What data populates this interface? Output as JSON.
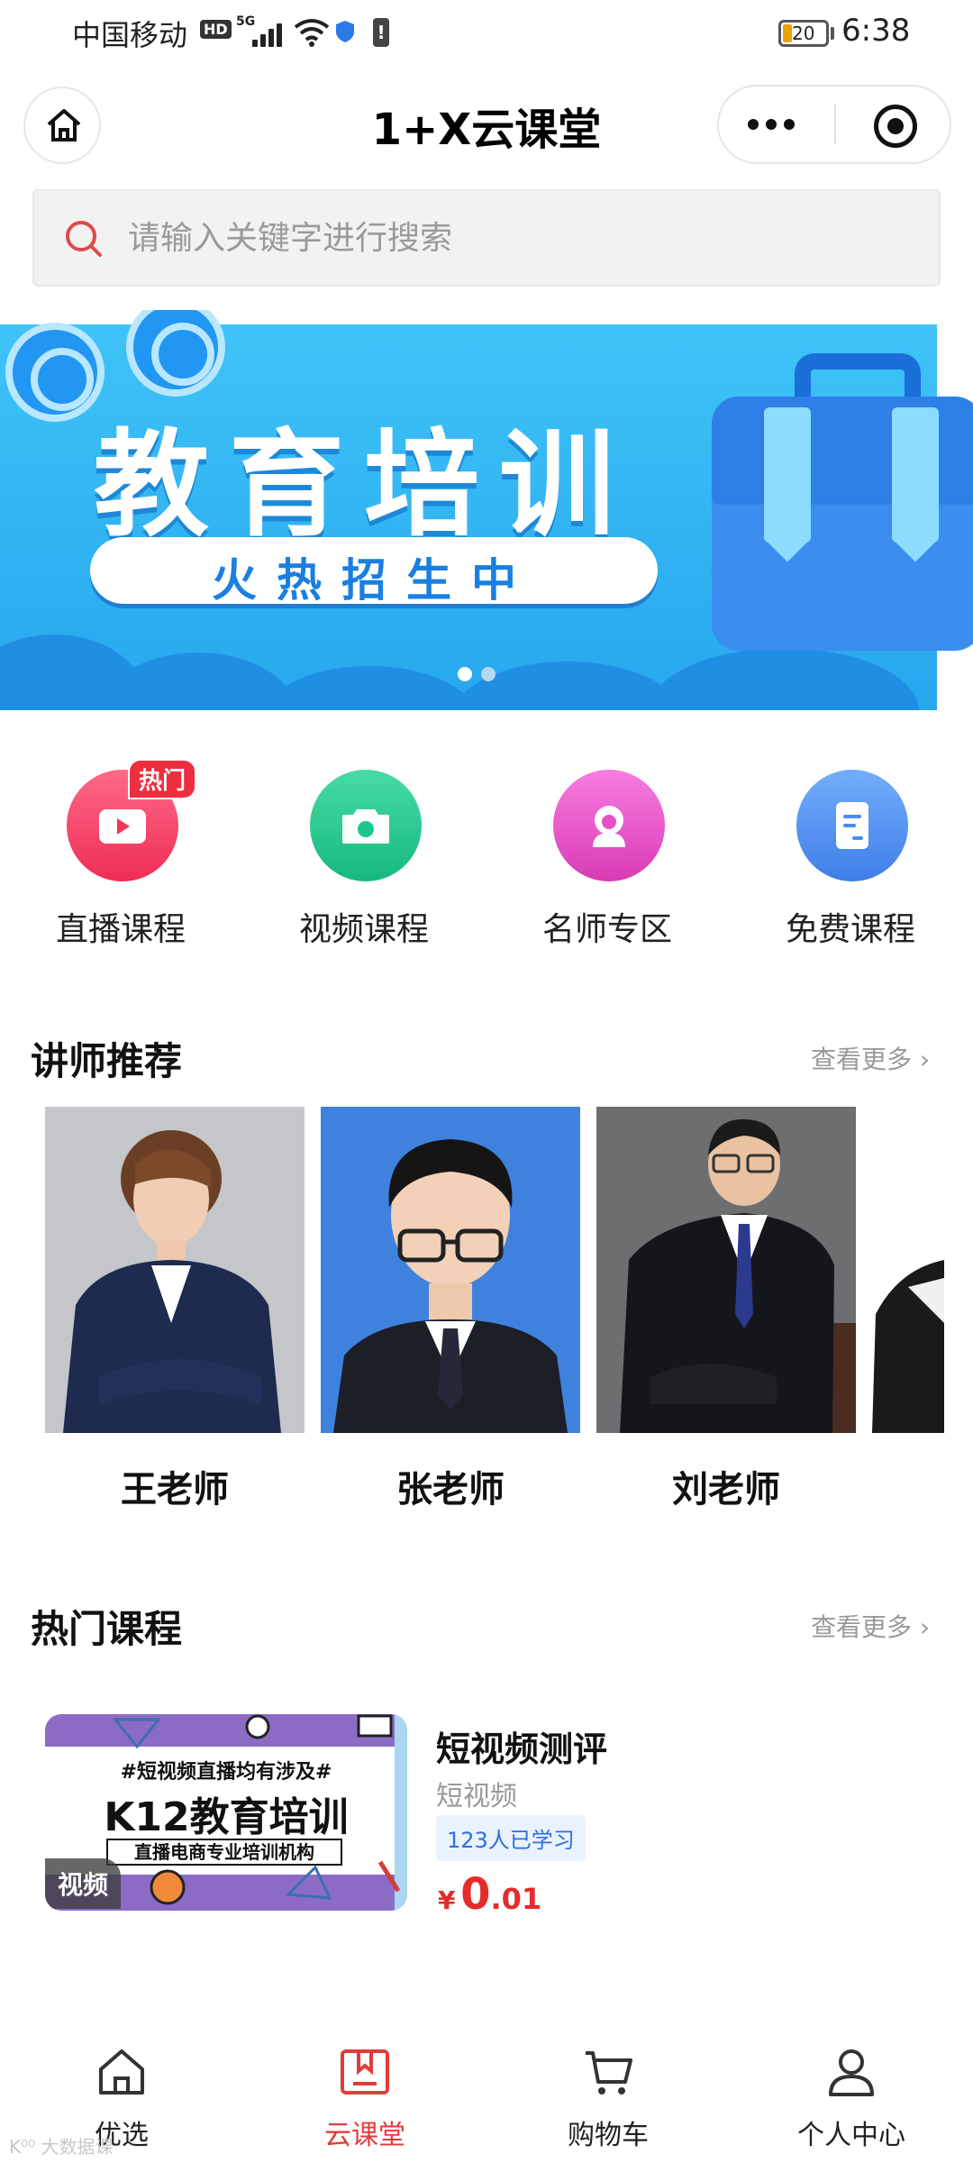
{
  "status_bar": {
    "carrier": "中国移动",
    "hd": "HD",
    "network": "5G",
    "battery": "20",
    "time": "6:38"
  },
  "header": {
    "title": "1+X云课堂",
    "home_icon": "home-icon",
    "more_icon": "more-dots-icon",
    "close_icon": "target-close-icon"
  },
  "search": {
    "placeholder": "请输入关键字进行搜索",
    "icon": "search-icon",
    "accent": "#e04a4a"
  },
  "banner": {
    "title": "教育培训",
    "subtitle": "火热招生中",
    "page_count": 2,
    "active_page": 1
  },
  "categories": [
    {
      "label": "直播课程",
      "icon": "video-camera-icon",
      "color": "#f43a5e",
      "badge": "热门"
    },
    {
      "label": "视频课程",
      "icon": "camera-icon",
      "color": "#1dc68a"
    },
    {
      "label": "名师专区",
      "icon": "teacher-icon",
      "color": "#e94fc6"
    },
    {
      "label": "免费课程",
      "icon": "document-icon",
      "color": "#4a8cf0"
    }
  ],
  "teachers_section": {
    "title": "讲师推荐",
    "more": "查看更多",
    "teachers": [
      {
        "name": "王老师"
      },
      {
        "name": "张老师"
      },
      {
        "name": "刘老师"
      }
    ]
  },
  "courses_section": {
    "title": "热门课程",
    "more": "查看更多",
    "courses": [
      {
        "thumb_line1": "#短视频直播均有涉及#",
        "thumb_line2": "K12教育培训",
        "thumb_line3": "直播电商专业培训机构",
        "tag": "视频",
        "title": "短视频测评",
        "category": "短视频",
        "learners": "123人已学习",
        "price_symbol": "¥",
        "price_int": "0",
        "price_dec": ".01"
      }
    ]
  },
  "tabbar": {
    "active_color": "#e23c3c",
    "items": [
      {
        "label": "优选",
        "icon": "home-icon"
      },
      {
        "label": "云课堂",
        "icon": "bookmark-book-icon"
      },
      {
        "label": "购物车",
        "icon": "cart-icon"
      },
      {
        "label": "个人中心",
        "icon": "person-icon"
      }
    ]
  },
  "watermark": "K⁰⁰ 大数据课"
}
